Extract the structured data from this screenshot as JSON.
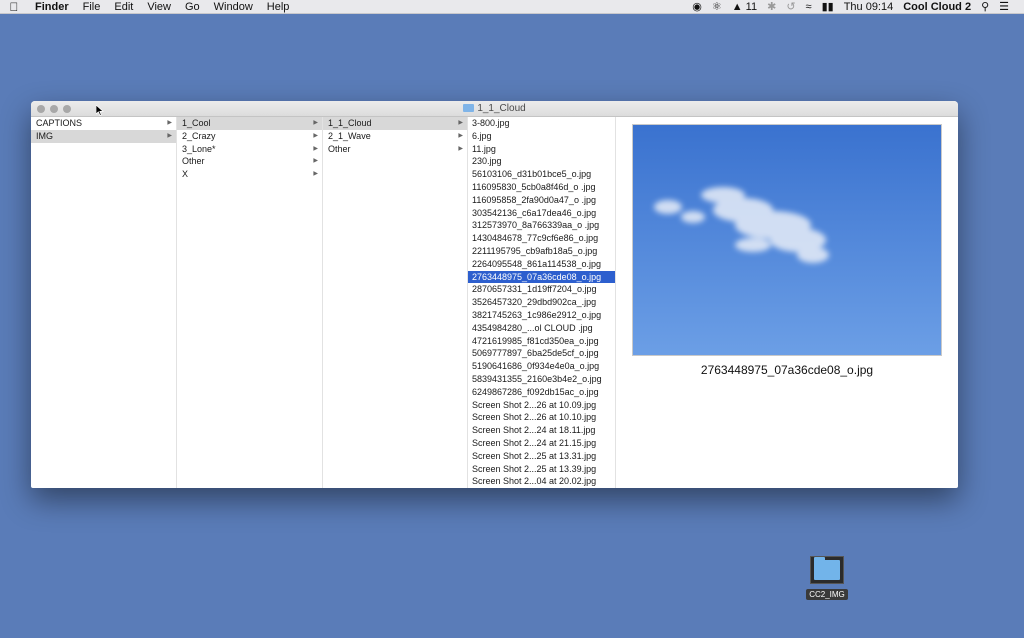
{
  "menubar": {
    "app_name": "Finder",
    "menus": [
      "File",
      "Edit",
      "View",
      "Go",
      "Window",
      "Help"
    ],
    "status": {
      "adobe_count": "11",
      "clock": "Thu 09:14",
      "user": "Cool Cloud 2"
    }
  },
  "window": {
    "title": "1_1_Cloud"
  },
  "columns": {
    "col1": [
      {
        "label": "CAPTIONS",
        "arrow": true,
        "selected": false
      },
      {
        "label": "IMG",
        "arrow": true,
        "selected": true
      }
    ],
    "col2": [
      {
        "label": "1_Cool",
        "arrow": true,
        "selected": true
      },
      {
        "label": "2_Crazy",
        "arrow": true,
        "selected": false
      },
      {
        "label": "3_Lone*",
        "arrow": true,
        "selected": false
      },
      {
        "label": "Other",
        "arrow": true,
        "selected": false
      },
      {
        "label": "X",
        "arrow": true,
        "selected": false
      }
    ],
    "col3": [
      {
        "label": "1_1_Cloud",
        "arrow": true,
        "selected": true
      },
      {
        "label": "2_1_Wave",
        "arrow": true,
        "selected": false
      },
      {
        "label": "Other",
        "arrow": true,
        "selected": false
      }
    ],
    "col4": [
      "3-800.jpg",
      "6.jpg",
      "11.jpg",
      "230.jpg",
      "56103106_d31b01bce5_o.jpg",
      "116095830_5cb0a8f46d_o .jpg",
      "116095858_2fa90d0a47_o .jpg",
      "303542136_c6a17dea46_o.jpg",
      "312573970_8a766339aa_o .jpg",
      "1430484678_77c9cf6e86_o.jpg",
      "2211195795_cb9afb18a5_o.jpg",
      "2264095548_861a114538_o.jpg",
      "2763448975_07a36cde08_o.jpg",
      "2870657331_1d19ff7204_o.jpg",
      "3526457320_29dbd902ca_.jpg",
      "3821745263_1c986e2912_o.jpg",
      "4354984280_...ol CLOUD .jpg",
      "4721619985_f81cd350ea_o.jpg",
      "5069777897_6ba25de5cf_o.jpg",
      "5190641686_0f934e4e0a_o.jpg",
      "5839431355_2160e3b4e2_o.jpg",
      "6249867286_f092db15ac_o.jpg",
      "Screen Shot 2...26 at 10.09.jpg",
      "Screen Shot 2...26 at 10.10.jpg",
      "Screen Shot 2...24 at 18.11.jpg",
      "Screen Shot 2...24 at 21.15.jpg",
      "Screen Shot 2...25 at 13.31.jpg",
      "Screen Shot 2...25 at 13.39.jpg",
      "Screen Shot 2...04 at 20.02.jpg"
    ],
    "col4_selected_index": 12
  },
  "preview": {
    "caption": "2763448975_07a36cde08_o.jpg"
  },
  "desktop": {
    "folder_label": "CC2_IMG"
  },
  "colors": {
    "desktop": "#5a7cb8",
    "selection_blue": "#2d5fce",
    "selection_grey": "#d8d8d8"
  }
}
